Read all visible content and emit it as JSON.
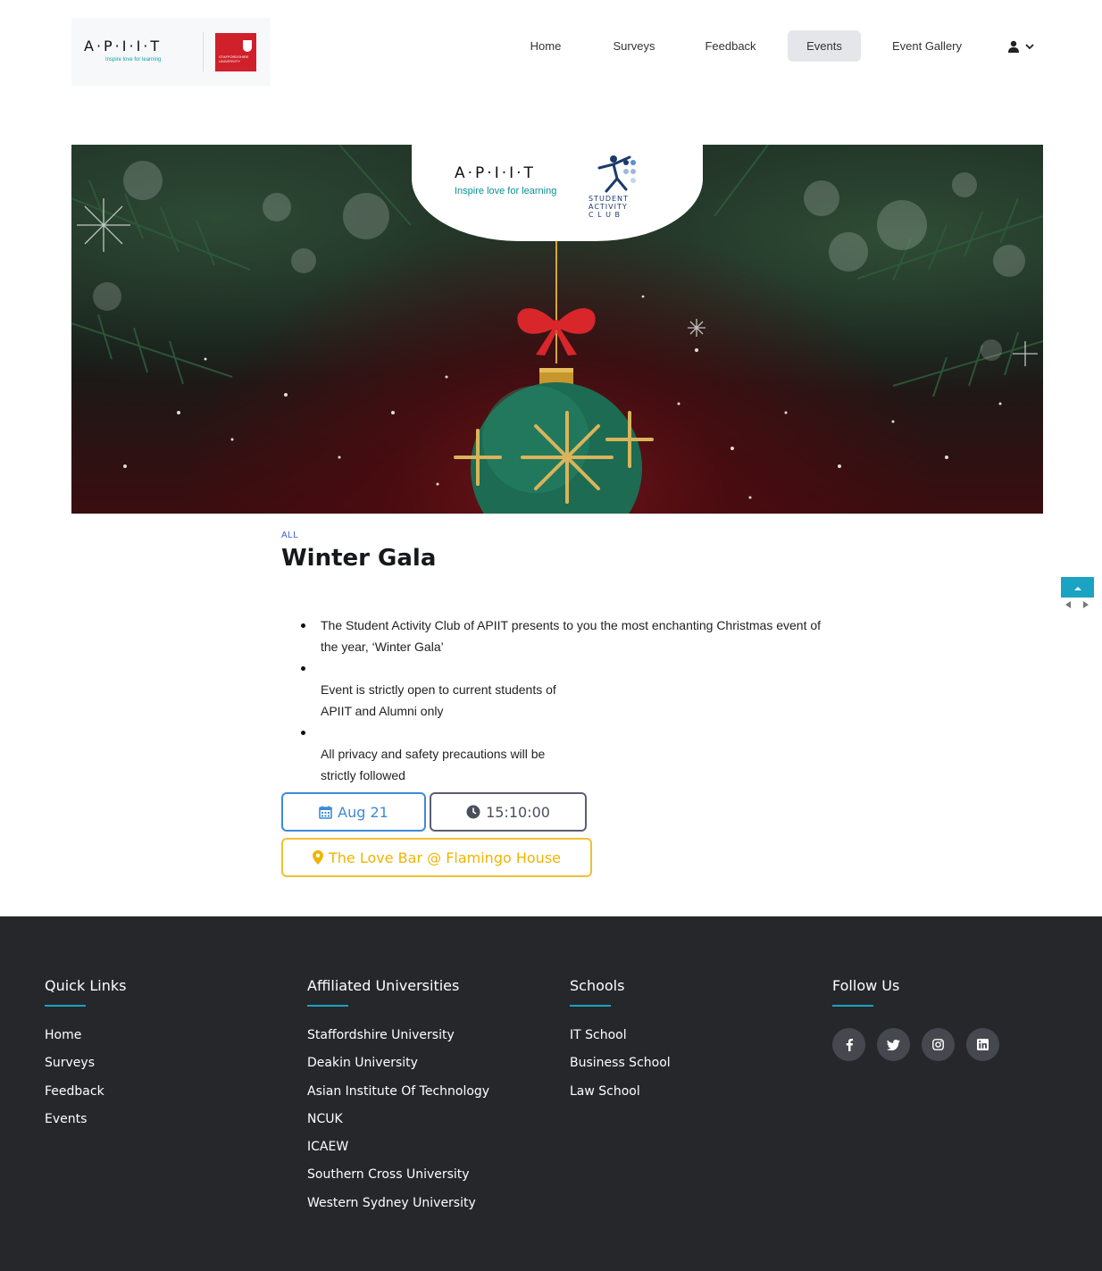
{
  "header": {
    "logo_word": "A·P·I·I·T",
    "logo_tagline": "Inspire love for learning",
    "partner_text": "STAFFORDSHIRE UNIVERSITY",
    "nav": [
      {
        "label": "Home",
        "active": false
      },
      {
        "label": "Surveys",
        "active": false
      },
      {
        "label": "Feedback",
        "active": false
      },
      {
        "label": "Events",
        "active": true
      },
      {
        "label": "Event Gallery",
        "active": false
      }
    ],
    "user_icon": "user-icon"
  },
  "hero": {
    "badge_word": "A·P·I·I·T",
    "badge_tagline": "Inspire love for learning",
    "club_line1": "STUDENT",
    "club_line2": "ACTIVITY",
    "club_line3": "C L U B"
  },
  "event": {
    "category": "ALL",
    "title": "Winter Gala",
    "bullets": [
      [
        "The Student Activity Club of APIIT presents to you the most enchanting Christmas event of",
        "the year, ‘Winter Gala’"
      ],
      [
        "Event is strictly open to current students of",
        "APIIT and Alumni only"
      ],
      [
        "All privacy and safety precautions will be",
        "strictly followed"
      ]
    ],
    "date": "Aug 21",
    "time": "15:10:00",
    "location": "The Love Bar @ Flamingo House"
  },
  "footer": {
    "quick_links": {
      "title": "Quick Links",
      "items": [
        "Home",
        "Surveys",
        "Feedback",
        "Events"
      ]
    },
    "universities": {
      "title": "Affiliated Universities",
      "items": [
        "Staffordshire University",
        "Deakin University",
        "Asian Institute Of Technology",
        "NCUK",
        "ICAEW",
        "Southern Cross University",
        "Western Sydney University"
      ]
    },
    "schools": {
      "title": "Schools",
      "items": [
        "IT School",
        "Business School",
        "Law School"
      ]
    },
    "follow": {
      "title": "Follow Us",
      "icons": [
        "facebook-icon",
        "twitter-icon",
        "instagram-icon",
        "linkedin-icon"
      ]
    }
  },
  "colors": {
    "accent": "#1aa3c2",
    "date_blue": "#3d8bd6",
    "location_gold": "#f0b400",
    "footer_bg": "#25272b"
  }
}
